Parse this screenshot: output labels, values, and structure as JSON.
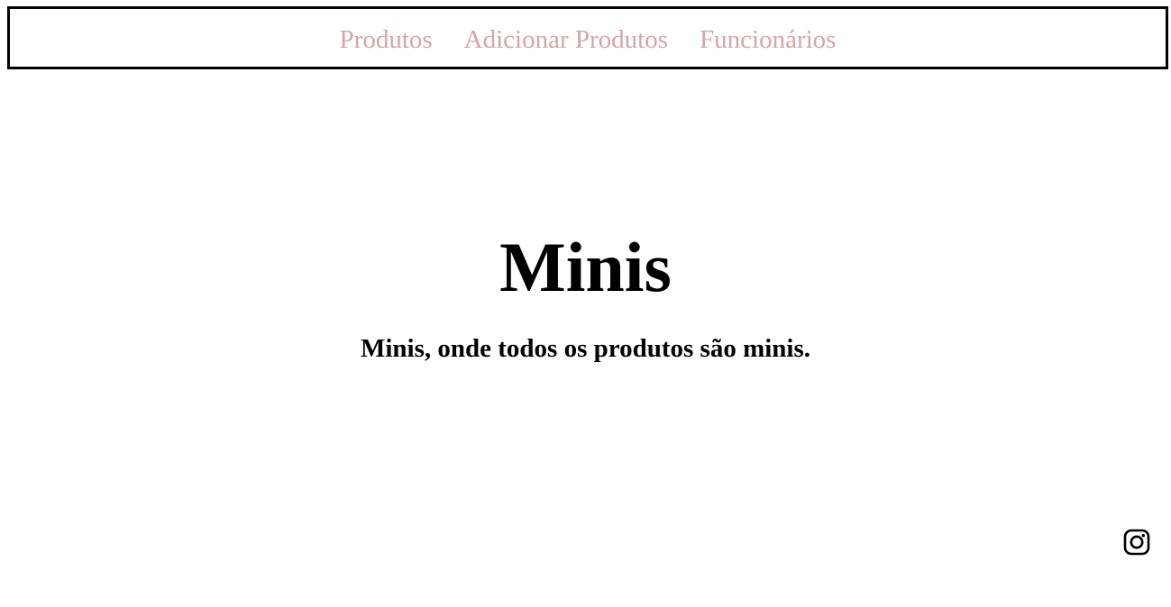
{
  "nav": {
    "items": [
      {
        "label": "Produtos"
      },
      {
        "label": "Adicionar Produtos"
      },
      {
        "label": "Funcionários"
      }
    ],
    "link_color": "#d4a5a5"
  },
  "hero": {
    "title": "Minis",
    "subtitle": "Minis, onde todos os produtos são minis."
  },
  "footer": {
    "social_icon": "instagram-icon"
  }
}
